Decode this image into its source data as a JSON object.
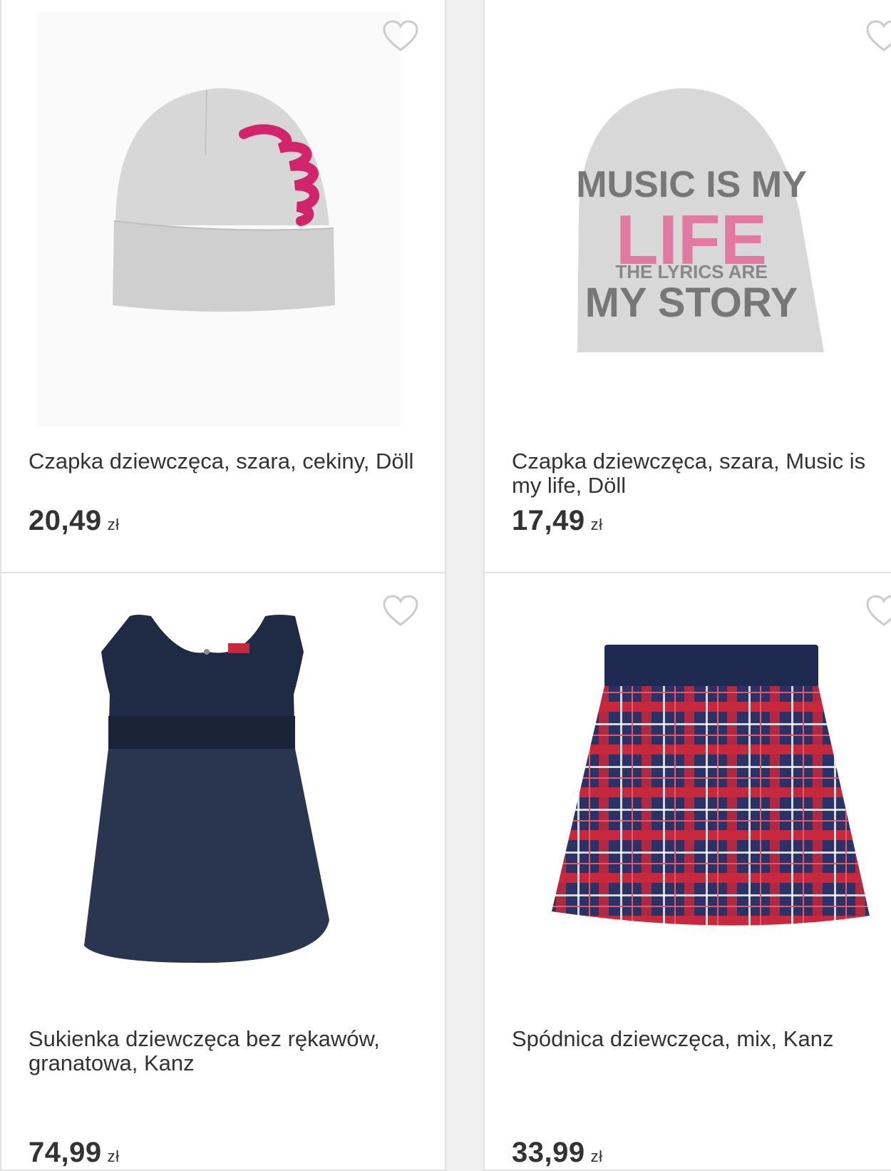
{
  "products": [
    {
      "title": "Czapka dziewczęca, szara, cekiny, Döll",
      "price": "20,49",
      "currency": "zł",
      "image_icon": "gray-beanie-sequin-image"
    },
    {
      "title_line1": "Czapka dziewczęca, szara, Music is",
      "title_line2": "my life, Döll",
      "price": "17,49",
      "currency": "zł",
      "image_icon": "gray-beanie-print-image",
      "print_text": {
        "line1": "MUSIC IS MY",
        "line2": "LIFE",
        "line3": "THE LYRICS ARE",
        "line4": "MY STORY"
      }
    },
    {
      "title": "Sukienka dziewczęca bez rękawów, granatowa, Kanz",
      "price": "74,99",
      "currency": "zł",
      "image_icon": "navy-dress-image"
    },
    {
      "title": "Spódnica dziewczęca, mix, Kanz",
      "price": "33,99",
      "currency": "zł",
      "image_icon": "plaid-skirt-image"
    }
  ],
  "colors": {
    "card_border": "#e2e2e2",
    "text": "#333333",
    "heart": "#cccccc",
    "beanie_gray": "#d6d6d6",
    "sequin_pink": "#d2246a",
    "navy": "#1f2a44",
    "plaid_red": "#c8283c"
  }
}
